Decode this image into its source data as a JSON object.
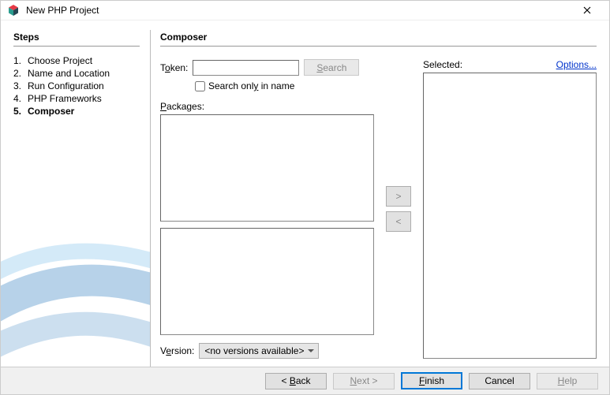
{
  "window": {
    "title": "New PHP Project"
  },
  "steps": {
    "heading": "Steps",
    "items": [
      {
        "num": "1.",
        "label": "Choose Project"
      },
      {
        "num": "2.",
        "label": "Name and Location"
      },
      {
        "num": "3.",
        "label": "Run Configuration"
      },
      {
        "num": "4.",
        "label": "PHP Frameworks"
      },
      {
        "num": "5.",
        "label": "Composer"
      }
    ],
    "current_index": 4
  },
  "panel": {
    "heading": "Composer",
    "token_label_pre": "T",
    "token_label_mn": "o",
    "token_label_post": "ken:",
    "token_value": "",
    "search_btn_mn": "S",
    "search_btn_post": "earch",
    "search_only_pre": "Search onl",
    "search_only_mn": "y",
    "search_only_post": " in name",
    "search_only_checked": false,
    "packages_label_mn": "P",
    "packages_label_post": "ackages:",
    "version_label_pre": "V",
    "version_label_mn": "e",
    "version_label_post": "rsion:",
    "version_value": "<no versions available>",
    "add_btn": ">",
    "remove_btn": "<",
    "selected_label": "Selected:",
    "options_pre": "Op",
    "options_mn": "t",
    "options_post": "ions..."
  },
  "footer": {
    "back_pre": "< ",
    "back_mn": "B",
    "back_post": "ack",
    "next_mn": "N",
    "next_post": "ext >",
    "finish_mn": "F",
    "finish_post": "inish",
    "cancel": "Cancel",
    "help_mn": "H",
    "help_post": "elp"
  }
}
